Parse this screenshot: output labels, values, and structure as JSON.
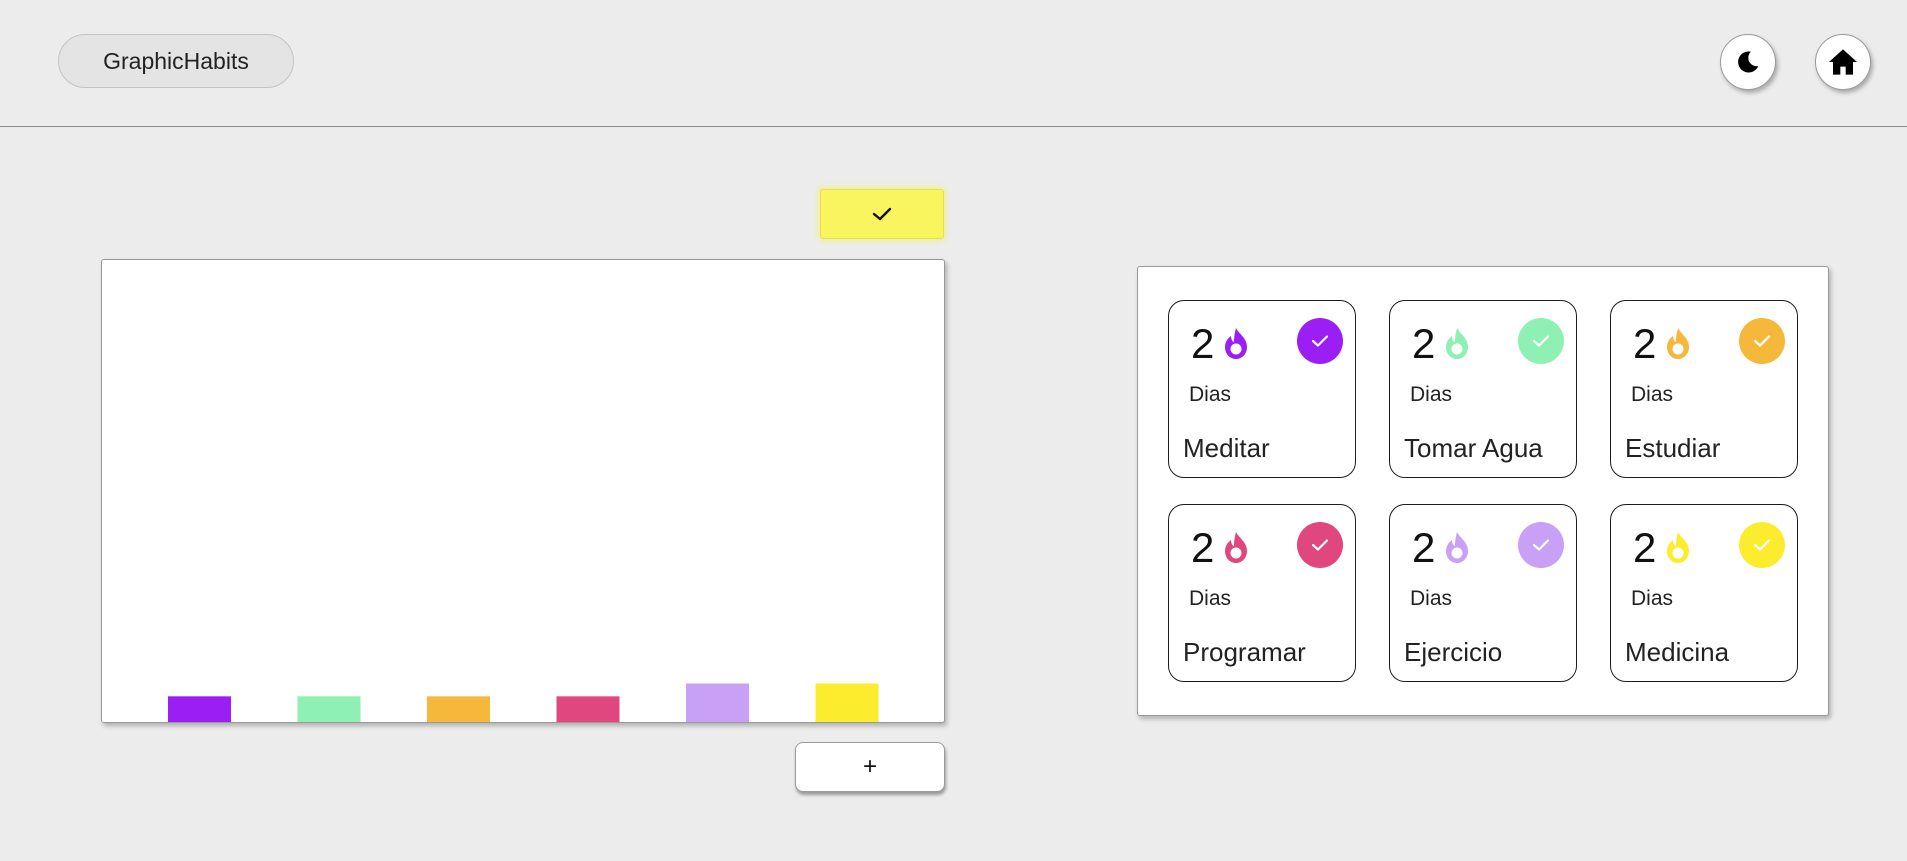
{
  "header": {
    "brand": "GraphicHabits",
    "theme_toggle_icon": "moon-icon",
    "home_icon": "home-icon"
  },
  "actions": {
    "confirm_icon": "check-icon",
    "confirm_color": "#f8f55e",
    "add_label": "+"
  },
  "chart_data": {
    "type": "bar",
    "categories": [
      "Meditar",
      "Tomar Agua",
      "Estudiar",
      "Programar",
      "Ejercicio",
      "Medicina"
    ],
    "values": [
      2,
      2,
      2,
      2,
      3,
      3
    ],
    "colors": [
      "#9b1ff5",
      "#8ef0b2",
      "#f5b83a",
      "#e0477f",
      "#c8a0f5",
      "#fbed2e"
    ],
    "title": "",
    "xlabel": "",
    "ylabel": "",
    "ylim": [
      0,
      36
    ],
    "grid": false,
    "legend": "none"
  },
  "habits": [
    {
      "name": "Meditar",
      "streak": "2",
      "unit": "Dias",
      "color": "#9b1ff5",
      "flame_icon": "flame-icon",
      "check_icon": "check-icon"
    },
    {
      "name": "Tomar Agua",
      "streak": "2",
      "unit": "Dias",
      "color": "#8ef0b2",
      "flame_icon": "flame-icon",
      "check_icon": "check-icon"
    },
    {
      "name": "Estudiar",
      "streak": "2",
      "unit": "Dias",
      "color": "#f5b83a",
      "flame_icon": "flame-icon",
      "check_icon": "check-icon"
    },
    {
      "name": "Programar",
      "streak": "2",
      "unit": "Dias",
      "color": "#e0477f",
      "flame_icon": "flame-icon",
      "check_icon": "check-icon"
    },
    {
      "name": "Ejercicio",
      "streak": "2",
      "unit": "Dias",
      "color": "#c8a0f5",
      "flame_icon": "flame-icon",
      "check_icon": "check-icon"
    },
    {
      "name": "Medicina",
      "streak": "2",
      "unit": "Dias",
      "color": "#fbed2e",
      "flame_icon": "flame-icon",
      "check_icon": "check-icon"
    }
  ]
}
